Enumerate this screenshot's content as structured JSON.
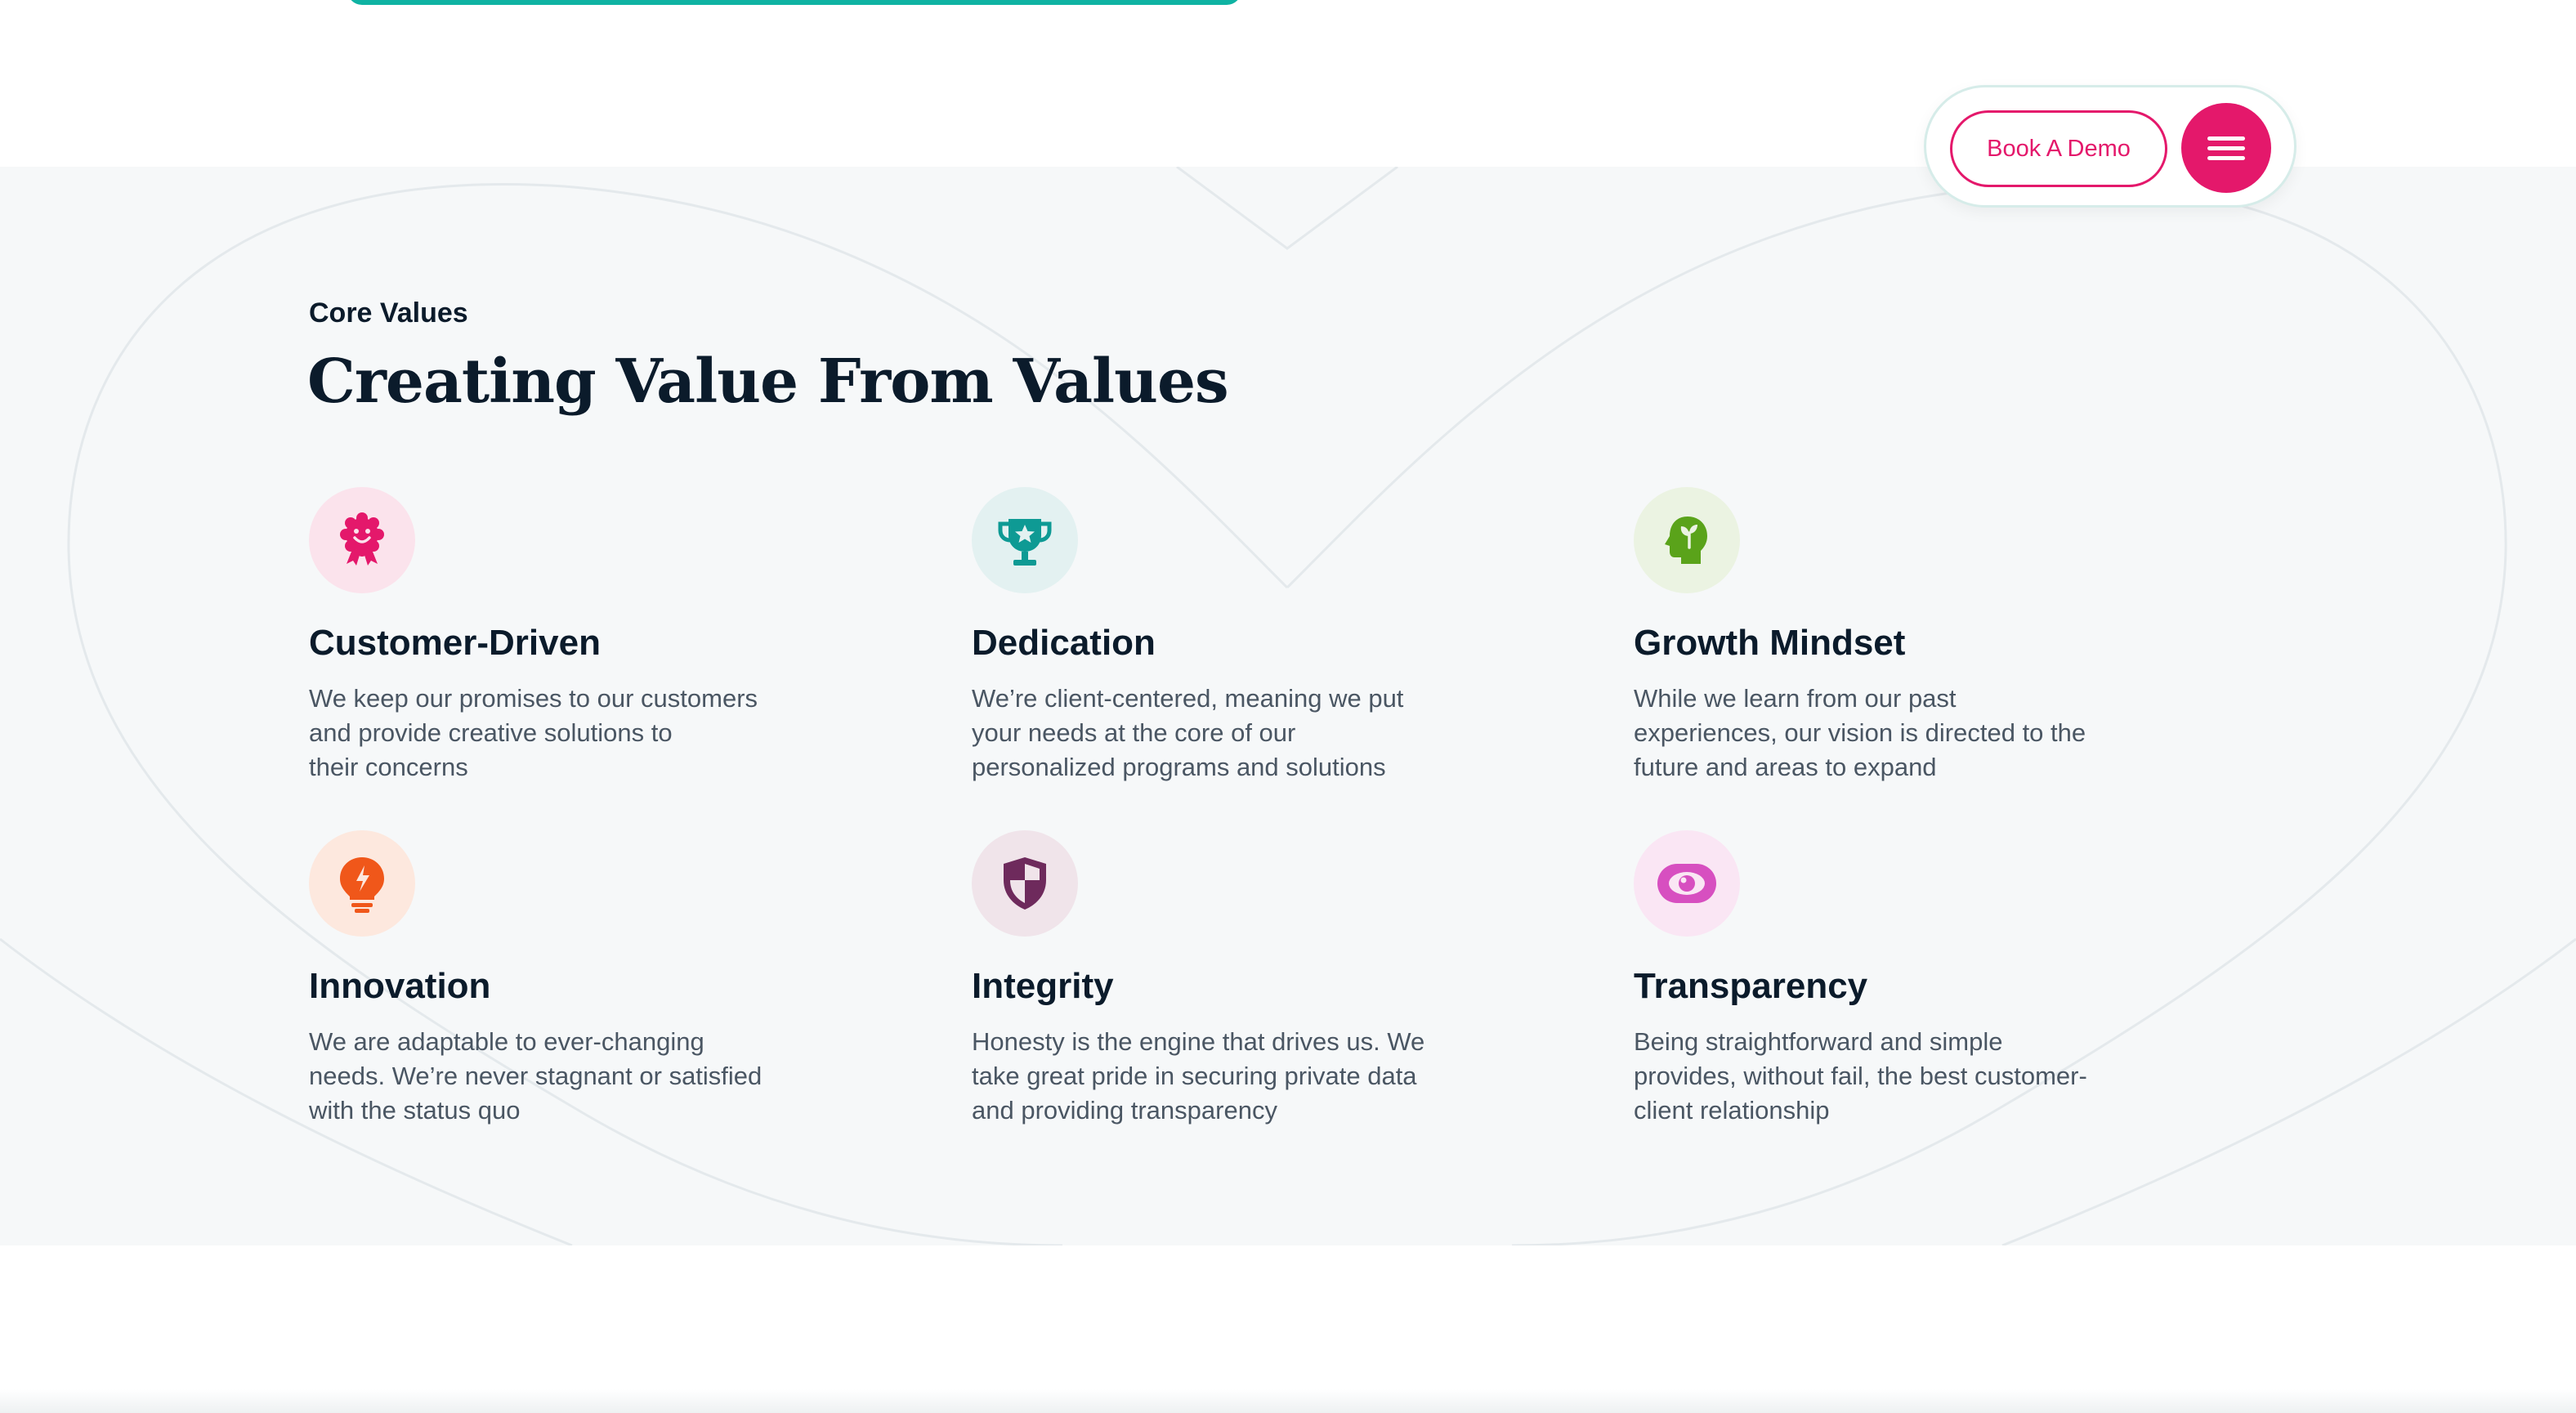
{
  "nav": {
    "demo_label": "Book A Demo",
    "menu_icon": "hamburger-menu-icon"
  },
  "section": {
    "eyebrow": "Core Values",
    "title": "Creating Value From Values"
  },
  "values": [
    {
      "title": "Customer-Driven",
      "icon": "smiley-badge-icon",
      "icon_color": "#e4186b",
      "icon_bg": "#fbe3ec",
      "lines": [
        "We keep our promises to our customers",
        "and provide creative solutions to",
        "their concerns"
      ]
    },
    {
      "title": "Dedication",
      "icon": "trophy-star-icon",
      "icon_color": "#0e9a94",
      "icon_bg": "#e3f1f1",
      "lines": [
        "We’re client-centered, meaning we put",
        "your needs at the core of our",
        "personalized programs and solutions"
      ]
    },
    {
      "title": "Growth Mindset",
      "icon": "head-sprout-icon",
      "icon_color": "#5aa31a",
      "icon_bg": "#ebf3e2",
      "lines": [
        "While we learn from our past",
        "experiences, our vision is directed to the",
        "future and areas to expand"
      ]
    },
    {
      "title": "Innovation",
      "icon": "lightbulb-bolt-icon",
      "icon_color": "#f0571a",
      "icon_bg": "#fde8de",
      "lines": [
        "We are adaptable to ever-changing",
        "needs. We’re never stagnant or satisfied",
        "with the status quo"
      ]
    },
    {
      "title": "Integrity",
      "icon": "shield-icon",
      "icon_color": "#6e2a5c",
      "icon_bg": "#f0e4ea",
      "lines": [
        "Honesty is the engine that drives us. We",
        "take great pride in securing private data",
        "and providing transparency"
      ]
    },
    {
      "title": "Transparency",
      "icon": "eye-icon",
      "icon_color": "#d74fc0",
      "icon_bg": "#fae6f4",
      "lines": [
        "Being straightforward and simple",
        "provides, without fail, the best customer-",
        "client relationship"
      ]
    }
  ],
  "colors": {
    "accent": "#e4186b",
    "teal": "#0fb3a3",
    "section_bg": "#f6f8f9",
    "text_dark": "#0b1b2b",
    "text_body": "#4a5663"
  }
}
